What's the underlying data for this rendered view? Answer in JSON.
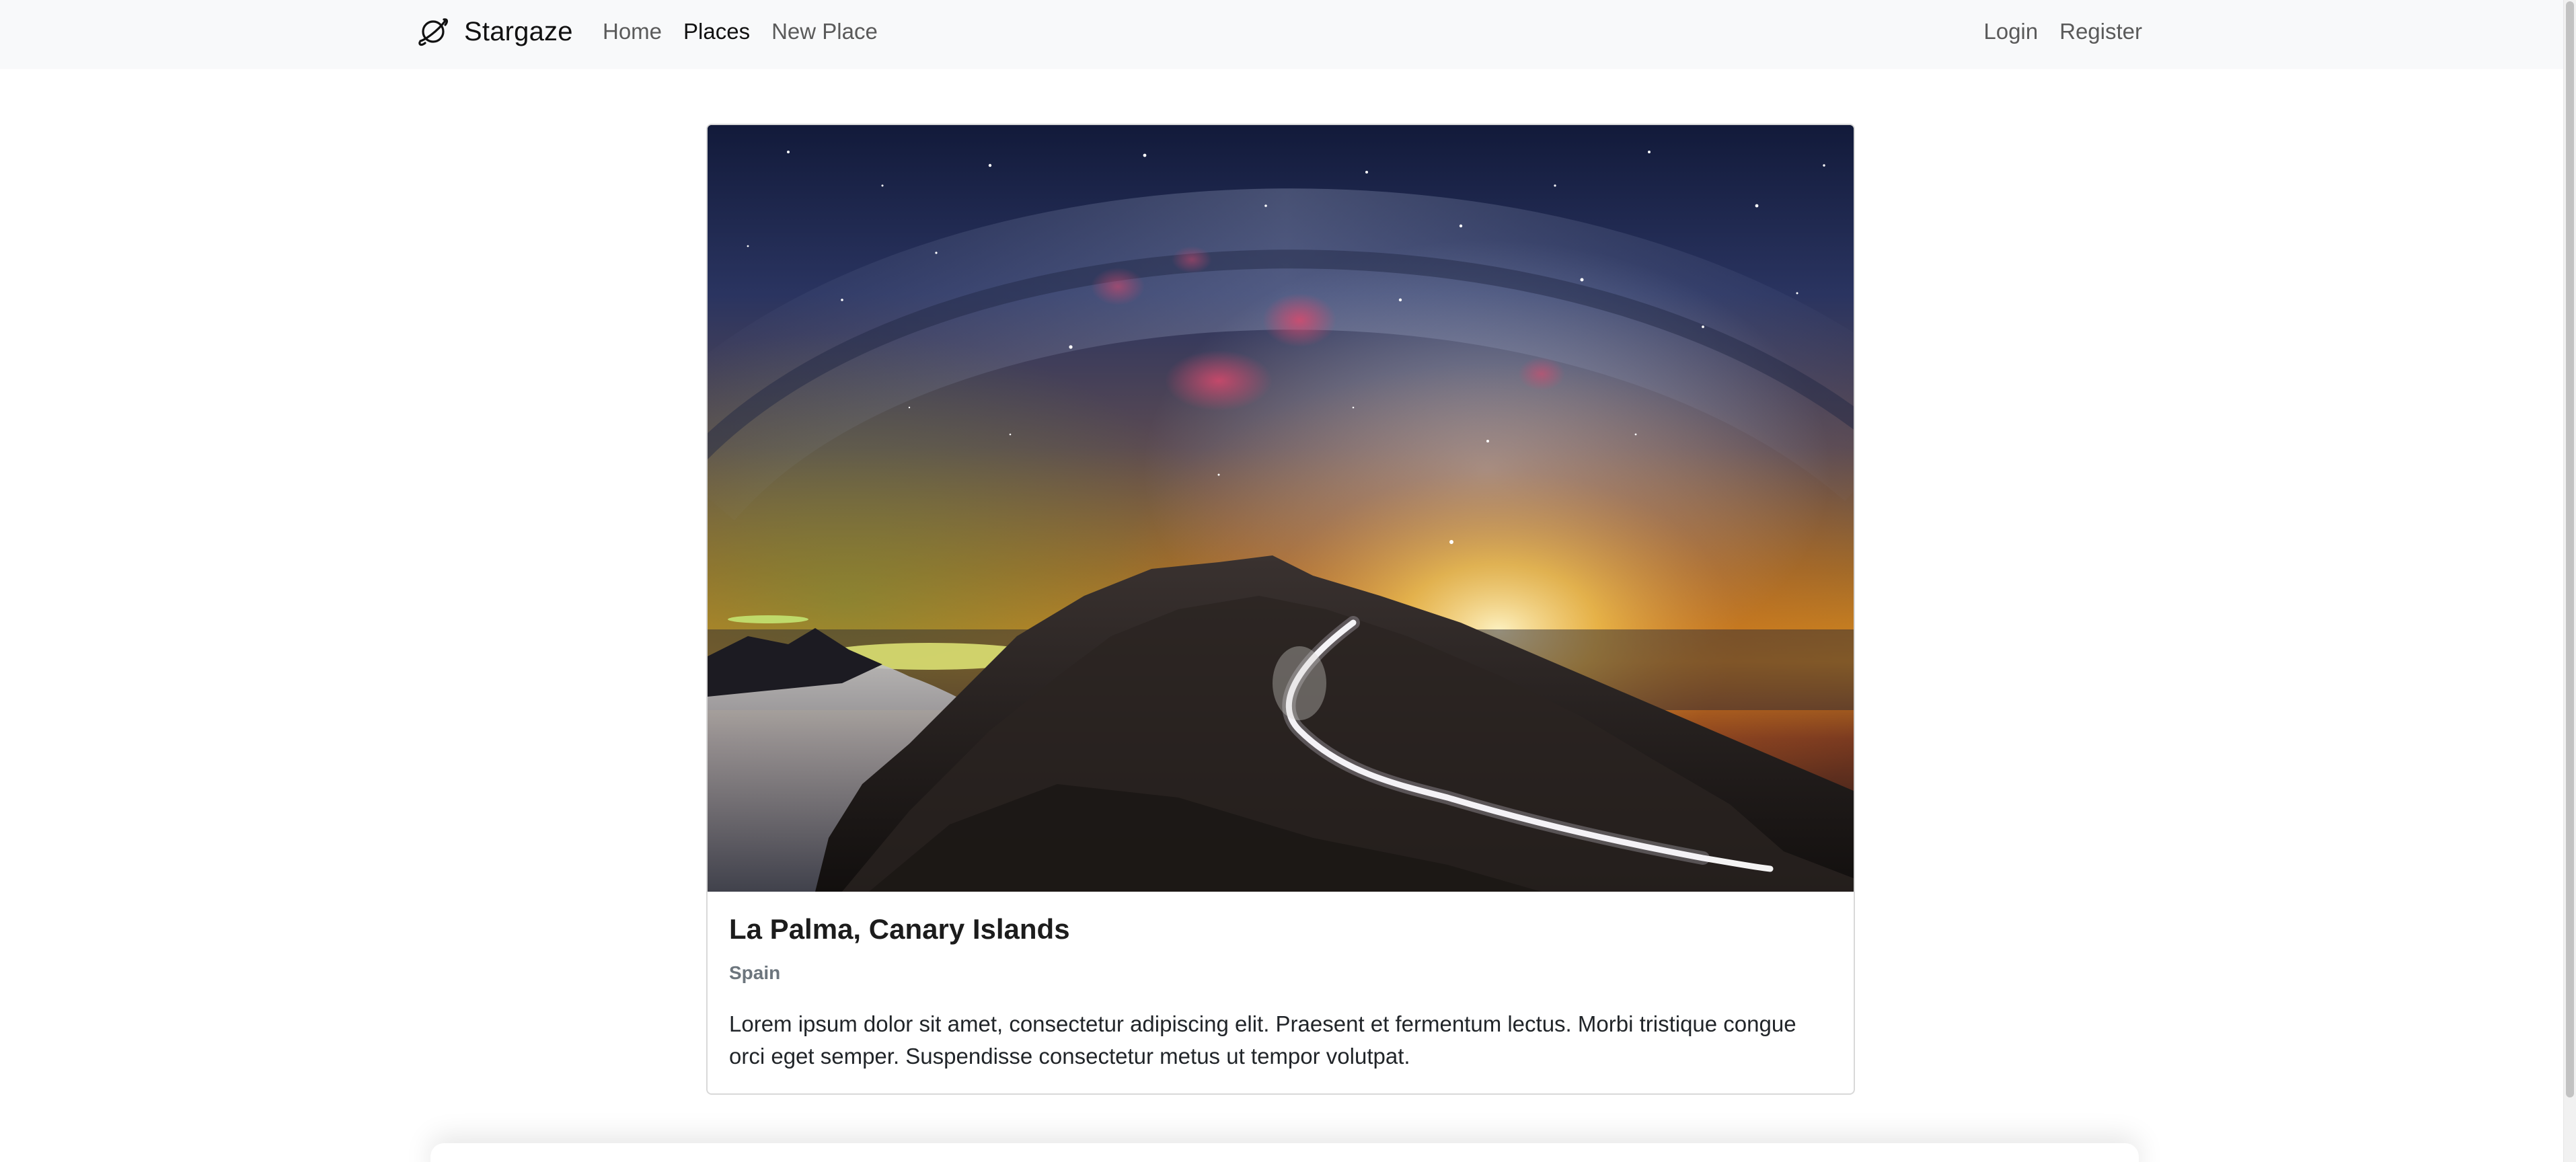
{
  "navbar": {
    "brand": "Stargaze",
    "brand_icon": "planet-icon",
    "links_left": [
      {
        "label": "Home",
        "active": false
      },
      {
        "label": "Places",
        "active": true
      },
      {
        "label": "New Place",
        "active": false
      }
    ],
    "links_right": [
      {
        "label": "Login"
      },
      {
        "label": "Register"
      }
    ]
  },
  "place": {
    "image": "night-sky-milky-way-mountain-road-photo",
    "title": "La Palma, Canary Islands",
    "country": "Spain",
    "description": "Lorem ipsum dolor sit amet, consectetur adipiscing elit. Praesent et fermentum lectus. Morbi tristique congue orci eget semper. Suspendisse consectetur metus ut tempor volutpat."
  },
  "colors": {
    "navbar_bg": "#f8f9fa",
    "link": "#5a5a5a",
    "link_active": "#111111",
    "subtitle": "#6c757d"
  }
}
